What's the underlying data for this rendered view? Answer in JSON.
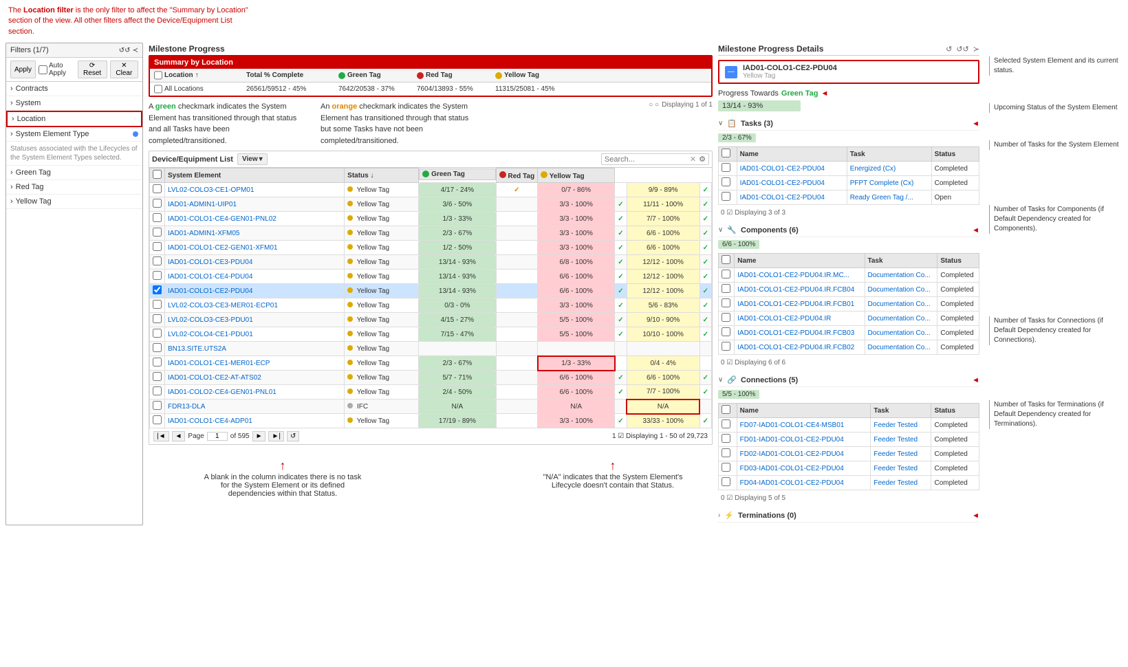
{
  "topInfo": {
    "text1": "The ",
    "bold": "Location filter",
    "text2": " is the only filter to affect the \"Summary by Location\" section of the view. All other filters affect the Device/Equipment List section."
  },
  "sidebar": {
    "header": "Filters (1/7)",
    "icons": [
      "↺↺",
      "≺"
    ],
    "controls": [
      "Apply",
      "Auto Apply",
      "Reset",
      "Clear"
    ],
    "items": [
      {
        "label": "Contracts",
        "type": "expand"
      },
      {
        "label": "System",
        "type": "expand"
      },
      {
        "label": "Location",
        "type": "expand",
        "active": true
      },
      {
        "label": "System Element Type",
        "type": "expand",
        "dot": true
      },
      {
        "label": "Green Tag",
        "type": "expand"
      },
      {
        "label": "Red Tag",
        "type": "expand"
      },
      {
        "label": "Yellow Tag",
        "type": "expand"
      }
    ]
  },
  "milestoneProgress": {
    "title": "Milestone Progress",
    "summarySection": "Summary by Location",
    "columns": {
      "location": "Location",
      "sortIcon": "↑",
      "total": "Total % Complete",
      "greenTag": "Green Tag",
      "redTag": "Red Tag",
      "yellowTag": "Yellow Tag"
    },
    "rows": [
      {
        "location": "All Locations",
        "total": "26561/59512 - 45%",
        "green": "7642/20538 - 37%",
        "red": "7604/13893 - 55%",
        "yellow": "11315/25081 - 45%"
      }
    ]
  },
  "infoBoxes": {
    "green": {
      "text": "A green checkmark indicates the System Element has transitioned through that status and all Tasks have been completed/transitioned."
    },
    "orange": {
      "text": "An orange checkmark indicates the System Element has transitioned through that status but some Tasks have not been completed/transitioned."
    },
    "statusNote": "Statuses associated with the Lifecycles of the System Element Types selected."
  },
  "deviceList": {
    "title": "Device/Equipment List",
    "viewBtn": "View",
    "searchPlaceholder": "Search...",
    "pagination": {
      "page": "1",
      "of": "of 595",
      "displaying": "Displaying 1 - 50 of 29,723",
      "displayingShort": "Displaying 1 of 1"
    },
    "columns": [
      "System Element",
      "Status",
      "Green Tag",
      "Red Tag",
      "Yellow Tag"
    ],
    "rows": [
      {
        "name": "LVL02-COLO3-CE1-OPM01",
        "status": "Yellow Tag",
        "statusDot": "yellow",
        "green": "4/17 - 24%",
        "red": "0/7 - 86%",
        "yellow": "9/9 - 89%",
        "greenCheck": "orange",
        "redCheck": "",
        "yellowCheck": "green"
      },
      {
        "name": "IAD01-ADMIN1-UIP01",
        "status": "Yellow Tag",
        "statusDot": "yellow",
        "green": "3/6 - 50%",
        "red": "3/3 - 100%",
        "yellow": "11/11 - 100%",
        "greenCheck": "",
        "redCheck": "green",
        "yellowCheck": "green"
      },
      {
        "name": "IAD01-COLO1-CE4-GEN01-PNL02",
        "status": "Yellow Tag",
        "statusDot": "yellow",
        "green": "1/3 - 33%",
        "red": "3/3 - 100%",
        "yellow": "7/7 - 100%",
        "greenCheck": "",
        "redCheck": "green",
        "yellowCheck": "green"
      },
      {
        "name": "IAD01-ADMIN1-XFM05",
        "status": "Yellow Tag",
        "statusDot": "yellow",
        "green": "2/3 - 67%",
        "red": "3/3 - 100%",
        "yellow": "6/6 - 100%",
        "greenCheck": "",
        "redCheck": "green",
        "yellowCheck": "green"
      },
      {
        "name": "IAD01-COLO1-CE2-GEN01-XFM01",
        "status": "Yellow Tag",
        "statusDot": "yellow",
        "green": "1/2 - 50%",
        "red": "3/3 - 100%",
        "yellow": "6/6 - 100%",
        "greenCheck": "",
        "redCheck": "green",
        "yellowCheck": "green"
      },
      {
        "name": "IAD01-COLO1-CE3-PDU04",
        "status": "Yellow Tag",
        "statusDot": "yellow",
        "green": "13/14 - 93%",
        "red": "6/8 - 100%",
        "yellow": "12/12 - 100%",
        "greenCheck": "",
        "redCheck": "green",
        "yellowCheck": "green"
      },
      {
        "name": "IAD01-COLO1-CE4-PDU04",
        "status": "Yellow Tag",
        "statusDot": "yellow",
        "green": "13/14 - 93%",
        "red": "6/6 - 100%",
        "yellow": "12/12 - 100%",
        "greenCheck": "",
        "redCheck": "green",
        "yellowCheck": "green"
      },
      {
        "name": "IAD01-COLO1-CE2-PDU04",
        "status": "Yellow Tag",
        "statusDot": "yellow",
        "green": "13/14 - 93%",
        "red": "6/6 - 100%",
        "yellow": "12/12 - 100%",
        "greenCheck": "",
        "redCheck": "green",
        "yellowCheck": "green",
        "selected": true
      },
      {
        "name": "LVL02-COLO3-CE3-MER01-ECP01",
        "status": "Yellow Tag",
        "statusDot": "yellow",
        "green": "0/3 - 0%",
        "red": "3/3 - 100%",
        "yellow": "5/6 - 83%",
        "greenCheck": "",
        "redCheck": "green",
        "yellowCheck": "green"
      },
      {
        "name": "LVL02-COLO3-CE3-PDU01",
        "status": "Yellow Tag",
        "statusDot": "yellow",
        "green": "4/15 - 27%",
        "red": "5/5 - 100%",
        "yellow": "9/10 - 90%",
        "greenCheck": "",
        "redCheck": "green",
        "yellowCheck": "green"
      },
      {
        "name": "LVL02-COLO4-CE1-PDU01",
        "status": "Yellow Tag",
        "statusDot": "yellow",
        "green": "7/15 - 47%",
        "red": "5/5 - 100%",
        "yellow": "10/10 - 100%",
        "greenCheck": "",
        "redCheck": "green",
        "yellowCheck": "green"
      },
      {
        "name": "BN13.SITE.UTS2A",
        "status": "Yellow Tag",
        "statusDot": "yellow",
        "green": "",
        "red": "",
        "yellow": "",
        "greenCheck": "",
        "redCheck": "",
        "yellowCheck": "",
        "blankRed": true
      },
      {
        "name": "IAD01-COLO1-CE1-MER01-ECP",
        "status": "Yellow Tag",
        "statusDot": "yellow",
        "green": "2/3 - 67%",
        "red": "1/3 - 33%",
        "yellow": "0/4 - 4%",
        "greenCheck": "",
        "redCheck": "",
        "yellowCheck": "",
        "redOutline": true
      },
      {
        "name": "IAD01-COLO1-CE2-AT-ATS02",
        "status": "Yellow Tag",
        "statusDot": "yellow",
        "green": "5/7 - 71%",
        "red": "6/6 - 100%",
        "yellow": "6/6 - 100%",
        "greenCheck": "",
        "redCheck": "green",
        "yellowCheck": "green"
      },
      {
        "name": "IAD01-COLO2-CE4-GEN01-PNL01",
        "status": "Yellow Tag",
        "statusDot": "yellow",
        "green": "2/4 - 50%",
        "red": "6/6 - 100%",
        "yellow": "7/7 - 100%",
        "greenCheck": "",
        "redCheck": "green",
        "yellowCheck": "green"
      },
      {
        "name": "FDR13-DLA",
        "status": "IFC",
        "statusDot": "grey",
        "green": "N/A",
        "red": "N/A",
        "yellow": "N/A",
        "greenCheck": "",
        "redCheck": "",
        "yellowCheck": "",
        "naYellow": true
      },
      {
        "name": "IAD01-COLO1-CE4-ADP01",
        "status": "Yellow Tag",
        "statusDot": "yellow",
        "green": "17/19 - 89%",
        "red": "3/3 - 100%",
        "yellow": "33/33 - 100%",
        "greenCheck": "",
        "redCheck": "green",
        "yellowCheck": "green"
      }
    ]
  },
  "rightPanel": {
    "title": "Milestone Progress Details",
    "icons": [
      "↺",
      "↺↺",
      "≻"
    ],
    "systemElement": {
      "name": "IAD01-COLO1-CE2-PDU04",
      "tag": "Yellow Tag"
    },
    "progressLabel": "Progress Towards",
    "progressTarget": "Green Tag",
    "progressBar": "13/14 - 93%",
    "tasks": {
      "label": "Tasks (3)",
      "progressBar": "2/3 - 67%",
      "columns": [
        "Name",
        "Task",
        "Status"
      ],
      "rows": [
        {
          "name": "IAD01-COLO1-CE2-PDU04",
          "task": "Energized (Cx)",
          "status": "Completed"
        },
        {
          "name": "IAD01-COLO1-CE2-PDU04",
          "task": "PFPT Complete (Cx)",
          "status": "Completed"
        },
        {
          "name": "IAD01-COLO1-CE2-PDU04",
          "task": "Ready Green Tag /...",
          "status": "Open"
        }
      ],
      "footer": "0 ☑  Displaying 3 of 3"
    },
    "components": {
      "label": "Components (6)",
      "progressBar": "6/6 - 100%",
      "columns": [
        "Name",
        "Task",
        "Status"
      ],
      "rows": [
        {
          "name": "IAD01-COLO1-CE2-PDU04.IR.MC...",
          "task": "Documentation Co...",
          "status": "Completed"
        },
        {
          "name": "IAD01-COLO1-CE2-PDU04.IR.FCB04",
          "task": "Documentation Co...",
          "status": "Completed"
        },
        {
          "name": "IAD01-COLO1-CE2-PDU04.IR.FCB01",
          "task": "Documentation Co...",
          "status": "Completed"
        },
        {
          "name": "IAD01-COLO1-CE2-PDU04.IR",
          "task": "Documentation Co...",
          "status": "Completed"
        },
        {
          "name": "IAD01-COLO1-CE2-PDU04.IR.FCB03",
          "task": "Documentation Co...",
          "status": "Completed"
        },
        {
          "name": "IAD01-COLO1-CE2-PDU04.IR.FCB02",
          "task": "Documentation Co...",
          "status": "Completed"
        }
      ],
      "footer": "0 ☑  Displaying 6 of 6"
    },
    "connections": {
      "label": "Connections (5)",
      "progressBar": "5/5 - 100%",
      "columns": [
        "Name",
        "Task",
        "Status"
      ],
      "rows": [
        {
          "name": "FD07-IAD01-COLO1-CE4-MSB01",
          "task": "Feeder Tested",
          "status": "Completed"
        },
        {
          "name": "FD01-IAD01-COLO1-CE2-PDU04",
          "task": "Feeder Tested",
          "status": "Completed"
        },
        {
          "name": "FD02-IAD01-COLO1-CE2-PDU04",
          "task": "Feeder Tested",
          "status": "Completed"
        },
        {
          "name": "FD03-IAD01-COLO1-CE2-PDU04",
          "task": "Feeder Tested",
          "status": "Completed"
        },
        {
          "name": "FD04-IAD01-COLO1-CE2-PDU04",
          "task": "Feeder Tested",
          "status": "Completed"
        }
      ],
      "footer": "0 ☑  Displaying 5 of 5"
    },
    "terminations": {
      "label": "Terminations (0)"
    }
  },
  "annotations": {
    "selectedSysElem": "Selected System Element and its current status.",
    "upcomingStatus": "Upcoming Status of the System Element",
    "numTasksSysElem": "Number of Tasks for the System Element",
    "numTasksComponents": "Number of Tasks for Components (if Default Dependency created for Components).",
    "numTasksConnections": "Number of Tasks for Connections (if Default Dependency created for Connections).",
    "numTasksTerminations": "Number of Tasks for Terminations (if Default Dependency created for Terminations)."
  },
  "bottomAnnotations": {
    "blank": "A blank in the column indicates there is no task for the System Element or its defined dependencies within that Status.",
    "na": "\"N/A\" indicates that the System Element's Lifecycle doesn't contain that Status."
  }
}
